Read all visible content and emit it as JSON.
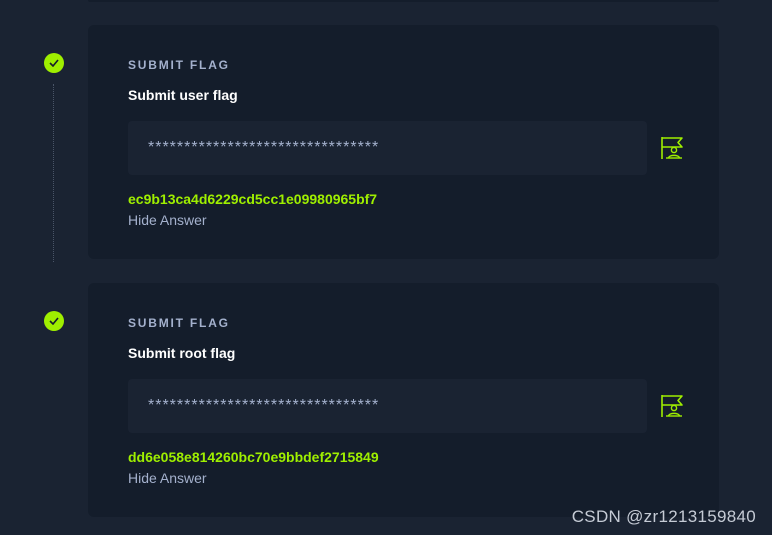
{
  "colors": {
    "background": "#1a2332",
    "card": "#141d2b",
    "accent": "#9fef00",
    "muted_text": "#a4b1cd"
  },
  "tasks": [
    {
      "status_icon": "check-icon",
      "overline": "SUBMIT FLAG",
      "title": "Submit user flag",
      "input_value": "********************************",
      "submit_icon": "flag-user-icon",
      "answer": "ec9b13ca4d6229cd5cc1e09980965bf7",
      "hide_label": "Hide Answer"
    },
    {
      "status_icon": "check-icon",
      "overline": "SUBMIT FLAG",
      "title": "Submit root flag",
      "input_value": "********************************",
      "submit_icon": "flag-user-icon",
      "answer": "dd6e058e814260bc70e9bbdef2715849",
      "hide_label": "Hide Answer"
    }
  ],
  "watermark": "CSDN @zr1213159840"
}
